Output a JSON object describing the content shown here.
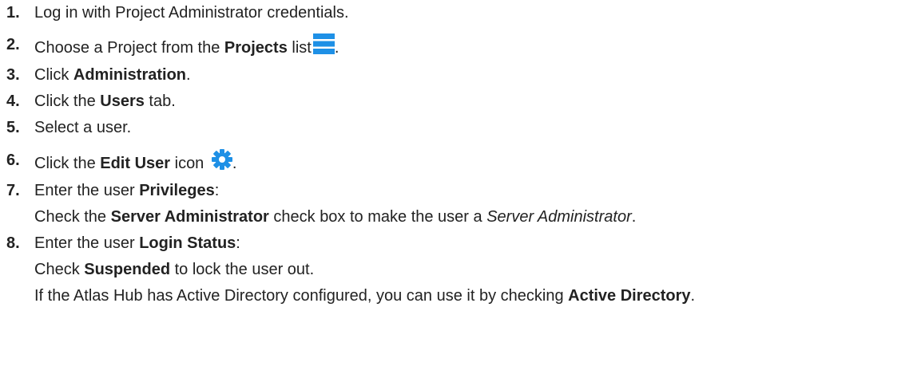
{
  "steps": [
    {
      "number": "1.",
      "parts": [
        "Log in with Project Administrator credentials."
      ]
    },
    {
      "number": "2.",
      "parts": [
        "Choose a Project from the ",
        "Projects",
        " list",
        "."
      ],
      "icon": "list-icon"
    },
    {
      "number": "3.",
      "parts": [
        "Click ",
        "Administration",
        "."
      ]
    },
    {
      "number": "4.",
      "parts": [
        "Click the ",
        "Users",
        " tab."
      ]
    },
    {
      "number": "5.",
      "parts": [
        "Select a user."
      ]
    },
    {
      "number": "6.",
      "parts": [
        "Click the ",
        "Edit User",
        " icon ",
        "."
      ],
      "icon": "gear-icon"
    },
    {
      "number": "7.",
      "parts": [
        "Enter the user ",
        "Privileges",
        ":"
      ],
      "sub": [
        [
          "Check the ",
          "Server Administrator",
          " check box to make the user a ",
          "Server Administrator",
          "."
        ]
      ]
    },
    {
      "number": "8.",
      "parts": [
        "Enter the user ",
        "Login Status",
        ":"
      ],
      "sub": [
        [
          "Check ",
          "Suspended",
          " to lock the user out."
        ],
        [
          "If the Atlas Hub has Active Directory configured, you can use it by checking ",
          "Active Directory",
          "."
        ]
      ]
    }
  ],
  "colors": {
    "text": "#222222",
    "icon_blue": "#1e90e6"
  }
}
